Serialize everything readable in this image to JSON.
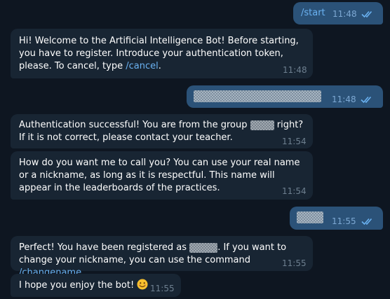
{
  "colors": {
    "background": "#0e1621",
    "outgoing_bubble": "#2b5278",
    "incoming_bubble": "#182533",
    "link": "#6ab2f2",
    "check_marks": "#6ab2f2"
  },
  "messages": [
    {
      "id": "m1",
      "direction": "outgoing",
      "text": "/start",
      "time": "11:48",
      "status_icon": "double-check-icon"
    },
    {
      "id": "m2",
      "direction": "incoming",
      "text": "Hi! Welcome to the Artificial Intelligence Bot! Before starting, you have to register. Introduce your authentication token, please. To cancel, type ",
      "link": "/cancel",
      "text_after": ".",
      "time": "11:48"
    },
    {
      "id": "m3",
      "direction": "outgoing",
      "redacted": true,
      "time": "11:48",
      "status_icon": "double-check-icon"
    },
    {
      "id": "m4",
      "direction": "incoming",
      "text": "Authentication successful! You are from the group ",
      "redacted": true,
      "text_after": " right? If it is not correct, please contact your teacher.",
      "time": "11:54"
    },
    {
      "id": "m5",
      "direction": "incoming",
      "text": "How do you want me to call you? You can use your real name or a nickname, as long as it is respectful. This name will appear in the leaderboards of the practices.",
      "time": "11:54"
    },
    {
      "id": "m6",
      "direction": "outgoing",
      "redacted": true,
      "time": "11:55",
      "status_icon": "double-check-icon"
    },
    {
      "id": "m7",
      "direction": "incoming",
      "text": "Perfect! You have been registered as ",
      "redacted": true,
      "text_mid": ". If you want to change your nickname, you can use the command ",
      "link": "/changename",
      "text_after": ".",
      "time": "11:55"
    },
    {
      "id": "m8",
      "direction": "incoming",
      "text": "I hope you enjoy the bot! ",
      "emoji": "smiling-face-icon",
      "time": "11:55"
    }
  ]
}
